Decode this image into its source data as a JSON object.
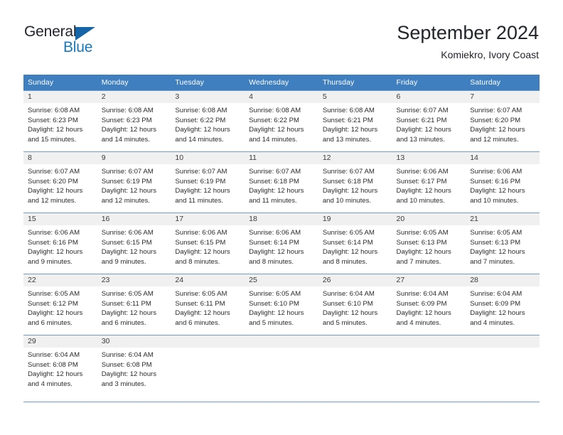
{
  "brand": {
    "name_part1": "General",
    "name_part2": "Blue",
    "triangle_icon": "blue-triangle-icon",
    "accent_dark": "#1565a8",
    "accent_blue": "#1878bd"
  },
  "header": {
    "title": "September 2024",
    "subtitle": "Komiekro, Ivory Coast"
  },
  "calendar": {
    "header_bg": "#3f7fbf",
    "daynum_bg": "#f0f0f0",
    "row_rule": "#6f9ecd",
    "weekdays": [
      "Sunday",
      "Monday",
      "Tuesday",
      "Wednesday",
      "Thursday",
      "Friday",
      "Saturday"
    ],
    "weeks": [
      [
        {
          "day": "1",
          "sunrise": "Sunrise: 6:08 AM",
          "sunset": "Sunset: 6:23 PM",
          "daylight_line1": "Daylight: 12 hours",
          "daylight_line2": "and 15 minutes."
        },
        {
          "day": "2",
          "sunrise": "Sunrise: 6:08 AM",
          "sunset": "Sunset: 6:23 PM",
          "daylight_line1": "Daylight: 12 hours",
          "daylight_line2": "and 14 minutes."
        },
        {
          "day": "3",
          "sunrise": "Sunrise: 6:08 AM",
          "sunset": "Sunset: 6:22 PM",
          "daylight_line1": "Daylight: 12 hours",
          "daylight_line2": "and 14 minutes."
        },
        {
          "day": "4",
          "sunrise": "Sunrise: 6:08 AM",
          "sunset": "Sunset: 6:22 PM",
          "daylight_line1": "Daylight: 12 hours",
          "daylight_line2": "and 14 minutes."
        },
        {
          "day": "5",
          "sunrise": "Sunrise: 6:08 AM",
          "sunset": "Sunset: 6:21 PM",
          "daylight_line1": "Daylight: 12 hours",
          "daylight_line2": "and 13 minutes."
        },
        {
          "day": "6",
          "sunrise": "Sunrise: 6:07 AM",
          "sunset": "Sunset: 6:21 PM",
          "daylight_line1": "Daylight: 12 hours",
          "daylight_line2": "and 13 minutes."
        },
        {
          "day": "7",
          "sunrise": "Sunrise: 6:07 AM",
          "sunset": "Sunset: 6:20 PM",
          "daylight_line1": "Daylight: 12 hours",
          "daylight_line2": "and 12 minutes."
        }
      ],
      [
        {
          "day": "8",
          "sunrise": "Sunrise: 6:07 AM",
          "sunset": "Sunset: 6:20 PM",
          "daylight_line1": "Daylight: 12 hours",
          "daylight_line2": "and 12 minutes."
        },
        {
          "day": "9",
          "sunrise": "Sunrise: 6:07 AM",
          "sunset": "Sunset: 6:19 PM",
          "daylight_line1": "Daylight: 12 hours",
          "daylight_line2": "and 12 minutes."
        },
        {
          "day": "10",
          "sunrise": "Sunrise: 6:07 AM",
          "sunset": "Sunset: 6:19 PM",
          "daylight_line1": "Daylight: 12 hours",
          "daylight_line2": "and 11 minutes."
        },
        {
          "day": "11",
          "sunrise": "Sunrise: 6:07 AM",
          "sunset": "Sunset: 6:18 PM",
          "daylight_line1": "Daylight: 12 hours",
          "daylight_line2": "and 11 minutes."
        },
        {
          "day": "12",
          "sunrise": "Sunrise: 6:07 AM",
          "sunset": "Sunset: 6:18 PM",
          "daylight_line1": "Daylight: 12 hours",
          "daylight_line2": "and 10 minutes."
        },
        {
          "day": "13",
          "sunrise": "Sunrise: 6:06 AM",
          "sunset": "Sunset: 6:17 PM",
          "daylight_line1": "Daylight: 12 hours",
          "daylight_line2": "and 10 minutes."
        },
        {
          "day": "14",
          "sunrise": "Sunrise: 6:06 AM",
          "sunset": "Sunset: 6:16 PM",
          "daylight_line1": "Daylight: 12 hours",
          "daylight_line2": "and 10 minutes."
        }
      ],
      [
        {
          "day": "15",
          "sunrise": "Sunrise: 6:06 AM",
          "sunset": "Sunset: 6:16 PM",
          "daylight_line1": "Daylight: 12 hours",
          "daylight_line2": "and 9 minutes."
        },
        {
          "day": "16",
          "sunrise": "Sunrise: 6:06 AM",
          "sunset": "Sunset: 6:15 PM",
          "daylight_line1": "Daylight: 12 hours",
          "daylight_line2": "and 9 minutes."
        },
        {
          "day": "17",
          "sunrise": "Sunrise: 6:06 AM",
          "sunset": "Sunset: 6:15 PM",
          "daylight_line1": "Daylight: 12 hours",
          "daylight_line2": "and 8 minutes."
        },
        {
          "day": "18",
          "sunrise": "Sunrise: 6:06 AM",
          "sunset": "Sunset: 6:14 PM",
          "daylight_line1": "Daylight: 12 hours",
          "daylight_line2": "and 8 minutes."
        },
        {
          "day": "19",
          "sunrise": "Sunrise: 6:05 AM",
          "sunset": "Sunset: 6:14 PM",
          "daylight_line1": "Daylight: 12 hours",
          "daylight_line2": "and 8 minutes."
        },
        {
          "day": "20",
          "sunrise": "Sunrise: 6:05 AM",
          "sunset": "Sunset: 6:13 PM",
          "daylight_line1": "Daylight: 12 hours",
          "daylight_line2": "and 7 minutes."
        },
        {
          "day": "21",
          "sunrise": "Sunrise: 6:05 AM",
          "sunset": "Sunset: 6:13 PM",
          "daylight_line1": "Daylight: 12 hours",
          "daylight_line2": "and 7 minutes."
        }
      ],
      [
        {
          "day": "22",
          "sunrise": "Sunrise: 6:05 AM",
          "sunset": "Sunset: 6:12 PM",
          "daylight_line1": "Daylight: 12 hours",
          "daylight_line2": "and 6 minutes."
        },
        {
          "day": "23",
          "sunrise": "Sunrise: 6:05 AM",
          "sunset": "Sunset: 6:11 PM",
          "daylight_line1": "Daylight: 12 hours",
          "daylight_line2": "and 6 minutes."
        },
        {
          "day": "24",
          "sunrise": "Sunrise: 6:05 AM",
          "sunset": "Sunset: 6:11 PM",
          "daylight_line1": "Daylight: 12 hours",
          "daylight_line2": "and 6 minutes."
        },
        {
          "day": "25",
          "sunrise": "Sunrise: 6:05 AM",
          "sunset": "Sunset: 6:10 PM",
          "daylight_line1": "Daylight: 12 hours",
          "daylight_line2": "and 5 minutes."
        },
        {
          "day": "26",
          "sunrise": "Sunrise: 6:04 AM",
          "sunset": "Sunset: 6:10 PM",
          "daylight_line1": "Daylight: 12 hours",
          "daylight_line2": "and 5 minutes."
        },
        {
          "day": "27",
          "sunrise": "Sunrise: 6:04 AM",
          "sunset": "Sunset: 6:09 PM",
          "daylight_line1": "Daylight: 12 hours",
          "daylight_line2": "and 4 minutes."
        },
        {
          "day": "28",
          "sunrise": "Sunrise: 6:04 AM",
          "sunset": "Sunset: 6:09 PM",
          "daylight_line1": "Daylight: 12 hours",
          "daylight_line2": "and 4 minutes."
        }
      ],
      [
        {
          "day": "29",
          "sunrise": "Sunrise: 6:04 AM",
          "sunset": "Sunset: 6:08 PM",
          "daylight_line1": "Daylight: 12 hours",
          "daylight_line2": "and 4 minutes."
        },
        {
          "day": "30",
          "sunrise": "Sunrise: 6:04 AM",
          "sunset": "Sunset: 6:08 PM",
          "daylight_line1": "Daylight: 12 hours",
          "daylight_line2": "and 3 minutes."
        },
        {
          "day": "",
          "sunrise": "",
          "sunset": "",
          "daylight_line1": "",
          "daylight_line2": ""
        },
        {
          "day": "",
          "sunrise": "",
          "sunset": "",
          "daylight_line1": "",
          "daylight_line2": ""
        },
        {
          "day": "",
          "sunrise": "",
          "sunset": "",
          "daylight_line1": "",
          "daylight_line2": ""
        },
        {
          "day": "",
          "sunrise": "",
          "sunset": "",
          "daylight_line1": "",
          "daylight_line2": ""
        },
        {
          "day": "",
          "sunrise": "",
          "sunset": "",
          "daylight_line1": "",
          "daylight_line2": ""
        }
      ]
    ]
  }
}
